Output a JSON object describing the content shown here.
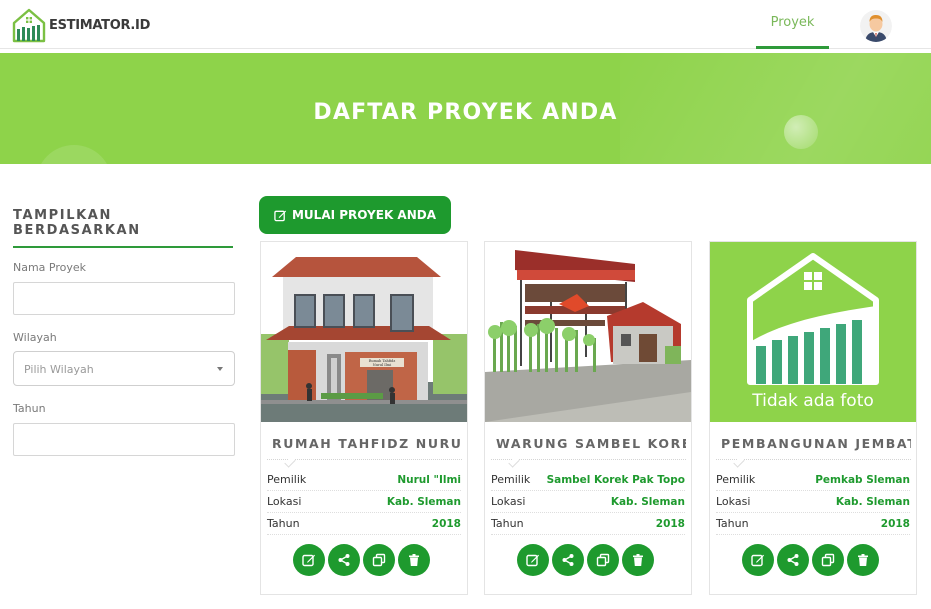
{
  "brand": {
    "name": "ESTIMATOR.ID"
  },
  "nav": {
    "proyek": "Proyek"
  },
  "banner": {
    "title": "DAFTAR PROYEK ANDA"
  },
  "filter": {
    "title": "TAMPILKAN BERDASARKAN",
    "nama_label": "Nama Proyek",
    "nama_value": "",
    "wilayah_label": "Wilayah",
    "wilayah_placeholder": "Pilih Wilayah",
    "tahun_label": "Tahun",
    "tahun_value": ""
  },
  "start_button": {
    "label": "MULAI PROYEK ANDA"
  },
  "labels": {
    "pemilik": "Pemilik",
    "lokasi": "Lokasi",
    "tahun": "Tahun"
  },
  "cards": [
    {
      "title": "RUMAH TAHFIDZ NURU...",
      "pemilik": "Nurul \"Ilmi",
      "lokasi": "Kab. Sleman",
      "tahun": "2018",
      "sign_line1": "Rumah Tahfidz",
      "sign_line2": "Nurul Ilmi"
    },
    {
      "title": "WARUNG SAMBEL KORE...",
      "pemilik": "Sambel Korek Pak Topo",
      "lokasi": "Kab. Sleman",
      "tahun": "2018"
    },
    {
      "title": "PEMBANGUNAN JEMBAT...",
      "pemilik": "Pemkab Sleman",
      "lokasi": "Kab. Sleman",
      "tahun": "2018",
      "no_photo": "Tidak ada foto"
    }
  ],
  "colors": {
    "green": "#1e9a2e",
    "banner": "#8ed34a",
    "accent_text": "#7ab85a"
  }
}
